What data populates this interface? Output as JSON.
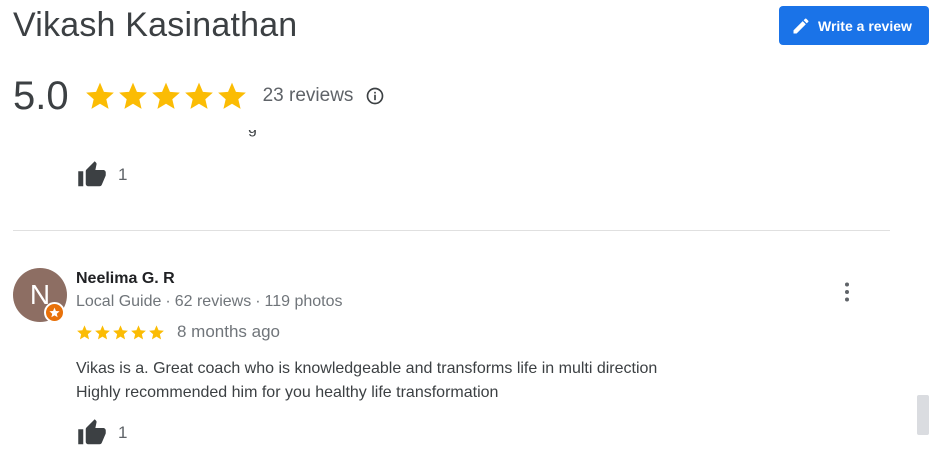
{
  "header": {
    "business_name": "Vikash Kasinathan",
    "write_review_label": "Write a review",
    "rating_value": "5.0",
    "rating_stars": 5,
    "reviews_count_label": "23 reviews"
  },
  "previous_review": {
    "likes": "1"
  },
  "review": {
    "avatar_initial": "N",
    "reviewer_name": "Neelima G. R",
    "reviewer_level": "Local Guide",
    "reviewer_reviews": "62 reviews",
    "reviewer_photos": "119 photos",
    "meta_separator": "·",
    "rating_stars": 5,
    "date": "8 months ago",
    "text_line_1": "Vikas is a. Great coach who is knowledgeable and transforms life in multi direction",
    "text_line_2": "Highly recommended him for you healthy life transformation",
    "likes": "1"
  },
  "colors": {
    "star": "#fbbc04",
    "primary_button": "#1a73e8",
    "avatar_bg": "#8d6e63",
    "local_guide_badge": "#e8710a"
  },
  "icons": {
    "write_review": "pencil-icon",
    "info": "info-icon",
    "like": "thumbs-up-icon",
    "more": "more-vert-icon",
    "local_guide": "local-guide-star-icon"
  }
}
